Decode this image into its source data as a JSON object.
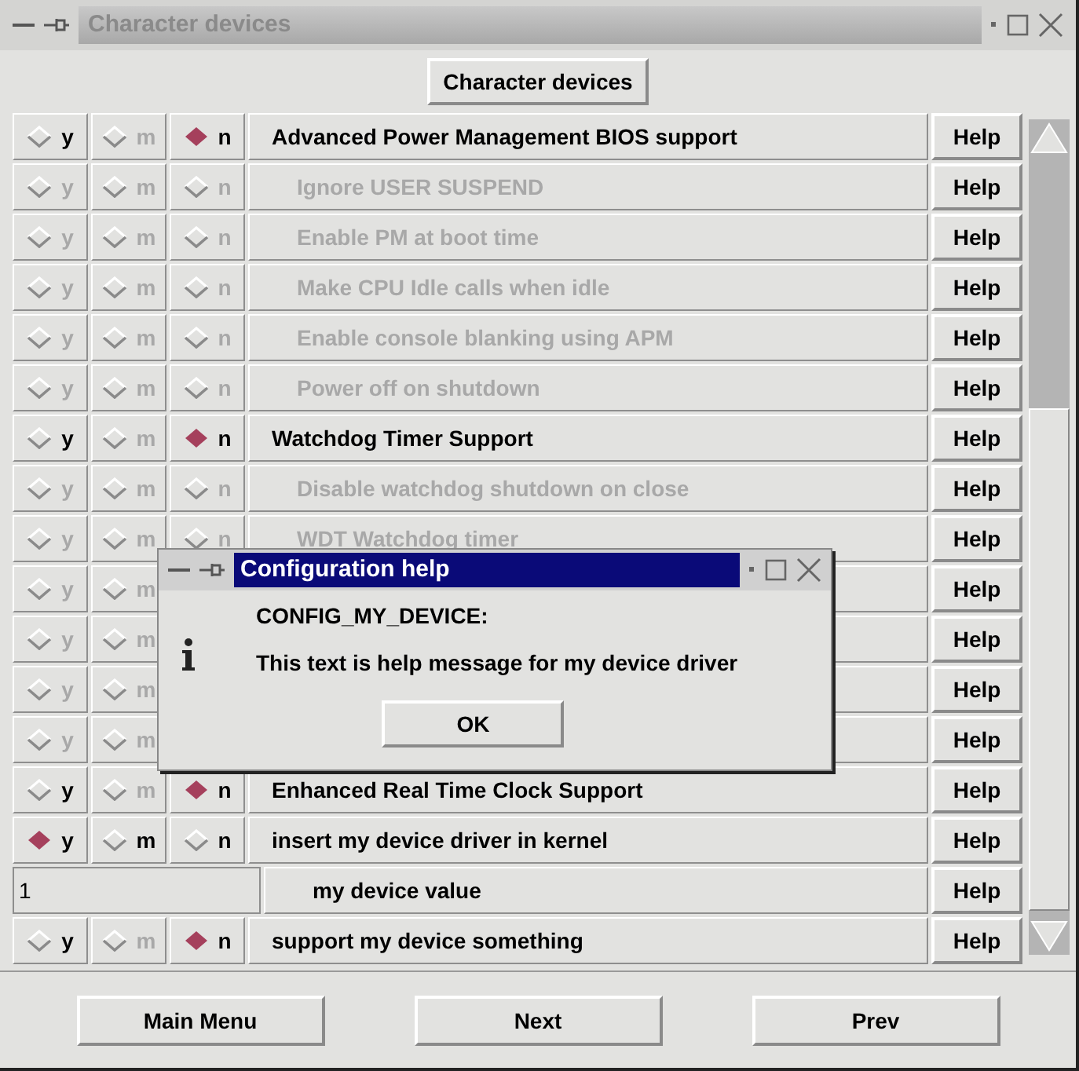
{
  "window": {
    "title": "Character devices",
    "active": false
  },
  "header_button": "Character devices",
  "rows": [
    {
      "kind": "choice",
      "label": "Advanced Power Management BIOS support",
      "disabled": false,
      "help": "Help",
      "options": [
        {
          "label": "y",
          "selected": false,
          "disabled": false
        },
        {
          "label": "m",
          "selected": false,
          "disabled": true
        },
        {
          "label": "n",
          "selected": true,
          "disabled": false
        }
      ],
      "children": [
        {
          "kind": "choice",
          "label": "Ignore USER SUSPEND",
          "disabled": true,
          "help": "Help",
          "options": [
            {
              "label": "y",
              "selected": false,
              "disabled": true
            },
            {
              "label": "m",
              "selected": false,
              "disabled": true
            },
            {
              "label": "n",
              "selected": false,
              "disabled": true
            }
          ]
        },
        {
          "kind": "choice",
          "label": "Enable PM at boot time",
          "disabled": true,
          "help": "Help",
          "options": [
            {
              "label": "y",
              "selected": false,
              "disabled": true
            },
            {
              "label": "m",
              "selected": false,
              "disabled": true
            },
            {
              "label": "n",
              "selected": false,
              "disabled": true
            }
          ]
        },
        {
          "kind": "choice",
          "label": "Make CPU Idle calls when idle",
          "disabled": true,
          "help": "Help",
          "options": [
            {
              "label": "y",
              "selected": false,
              "disabled": true
            },
            {
              "label": "m",
              "selected": false,
              "disabled": true
            },
            {
              "label": "n",
              "selected": false,
              "disabled": true
            }
          ]
        },
        {
          "kind": "choice",
          "label": "Enable console blanking using APM",
          "disabled": true,
          "help": "Help",
          "options": [
            {
              "label": "y",
              "selected": false,
              "disabled": true
            },
            {
              "label": "m",
              "selected": false,
              "disabled": true
            },
            {
              "label": "n",
              "selected": false,
              "disabled": true
            }
          ]
        },
        {
          "kind": "choice",
          "label": "Power off on shutdown",
          "disabled": true,
          "help": "Help",
          "options": [
            {
              "label": "y",
              "selected": false,
              "disabled": true
            },
            {
              "label": "m",
              "selected": false,
              "disabled": true
            },
            {
              "label": "n",
              "selected": false,
              "disabled": true
            }
          ]
        }
      ]
    },
    {
      "kind": "choice",
      "label": "Watchdog Timer Support",
      "disabled": false,
      "help": "Help",
      "options": [
        {
          "label": "y",
          "selected": false,
          "disabled": false
        },
        {
          "label": "m",
          "selected": false,
          "disabled": true
        },
        {
          "label": "n",
          "selected": true,
          "disabled": false
        }
      ],
      "children": [
        {
          "kind": "choice",
          "label": "Disable watchdog shutdown on close",
          "disabled": true,
          "help": "Help",
          "options": [
            {
              "label": "y",
              "selected": false,
              "disabled": true
            },
            {
              "label": "m",
              "selected": false,
              "disabled": true
            },
            {
              "label": "n",
              "selected": false,
              "disabled": true
            }
          ]
        },
        {
          "kind": "choice",
          "label": "WDT Watchdog timer",
          "disabled": true,
          "help": "Help",
          "options": [
            {
              "label": "y",
              "selected": false,
              "disabled": true
            },
            {
              "label": "m",
              "selected": false,
              "disabled": true
            },
            {
              "label": "n",
              "selected": false,
              "disabled": true
            }
          ]
        }
      ]
    },
    {
      "kind": "choice",
      "help": "Help",
      "options": [
        {
          "label": "y",
          "selected": false,
          "disabled": true
        },
        {
          "label": "m",
          "selected": false,
          "disabled": true
        }
      ]
    },
    {
      "kind": "choice",
      "help": "Help",
      "options": [
        {
          "label": "y",
          "selected": false,
          "disabled": true
        },
        {
          "label": "m",
          "selected": false,
          "disabled": true
        }
      ]
    },
    {
      "kind": "choice",
      "help": "Help",
      "options": [
        {
          "label": "y",
          "selected": false,
          "disabled": true
        },
        {
          "label": "m",
          "selected": false,
          "disabled": true
        }
      ]
    },
    {
      "kind": "choice",
      "help": "Help",
      "options": [
        {
          "label": "y",
          "selected": false,
          "disabled": true
        },
        {
          "label": "m",
          "selected": false,
          "disabled": true
        }
      ]
    },
    {
      "kind": "choice",
      "label": "Enhanced Real Time Clock Support",
      "disabled": false,
      "help": "Help",
      "options": [
        {
          "label": "y",
          "selected": false,
          "disabled": false
        },
        {
          "label": "m",
          "selected": false,
          "disabled": true
        },
        {
          "label": "n",
          "selected": true,
          "disabled": false
        }
      ]
    },
    {
      "kind": "choice",
      "label": "insert my device driver in kernel",
      "disabled": false,
      "help": "Help",
      "options": [
        {
          "label": "y",
          "selected": true,
          "disabled": false
        },
        {
          "label": "m",
          "selected": false,
          "disabled": false
        },
        {
          "label": "n",
          "selected": false,
          "disabled": false
        }
      ],
      "children": [
        {
          "kind": "value",
          "value": "1",
          "label": "my device value",
          "help": "Help"
        }
      ]
    },
    {
      "kind": "choice",
      "label": "support my device something",
      "disabled": false,
      "help": "Help",
      "options": [
        {
          "label": "y",
          "selected": false,
          "disabled": false
        },
        {
          "label": "m",
          "selected": false,
          "disabled": true
        },
        {
          "label": "n",
          "selected": true,
          "disabled": false
        }
      ]
    }
  ],
  "dialog": {
    "title": "Configuration help",
    "active": true,
    "heading": "CONFIG_MY_DEVICE:",
    "message": "This text is help message for my device driver",
    "button": "OK"
  },
  "footer_buttons": [
    "Main Menu",
    "Next",
    "Prev"
  ]
}
